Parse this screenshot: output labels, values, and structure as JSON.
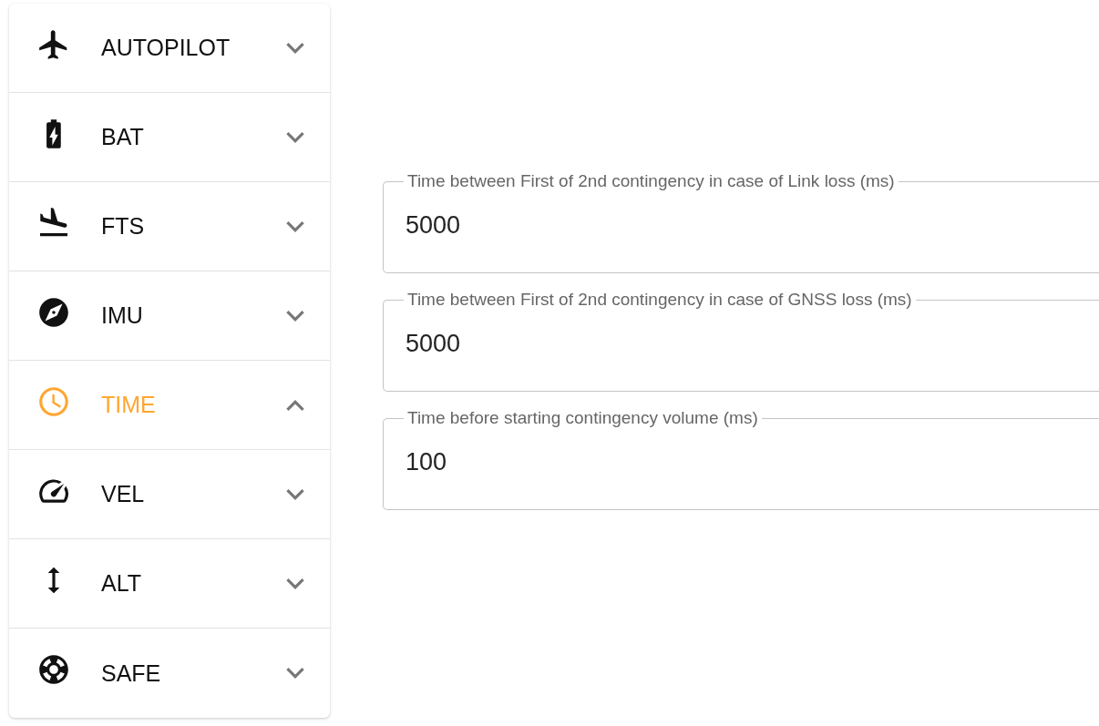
{
  "sidebar": {
    "items": [
      {
        "label": "AUTOPILOT",
        "expanded": false
      },
      {
        "label": "BAT",
        "expanded": false
      },
      {
        "label": "FTS",
        "expanded": false
      },
      {
        "label": "IMU",
        "expanded": false
      },
      {
        "label": "TIME",
        "expanded": true
      },
      {
        "label": "VEL",
        "expanded": false
      },
      {
        "label": "ALT",
        "expanded": false
      },
      {
        "label": "SAFE",
        "expanded": false
      }
    ]
  },
  "fields": [
    {
      "label": "Time between First of 2nd contingency in case of Link loss (ms)",
      "value": "5000"
    },
    {
      "label": "Time between First of 2nd contingency in case of GNSS loss (ms)",
      "value": "5000"
    },
    {
      "label": "Time before starting contingency volume (ms)",
      "value": "100"
    }
  ]
}
